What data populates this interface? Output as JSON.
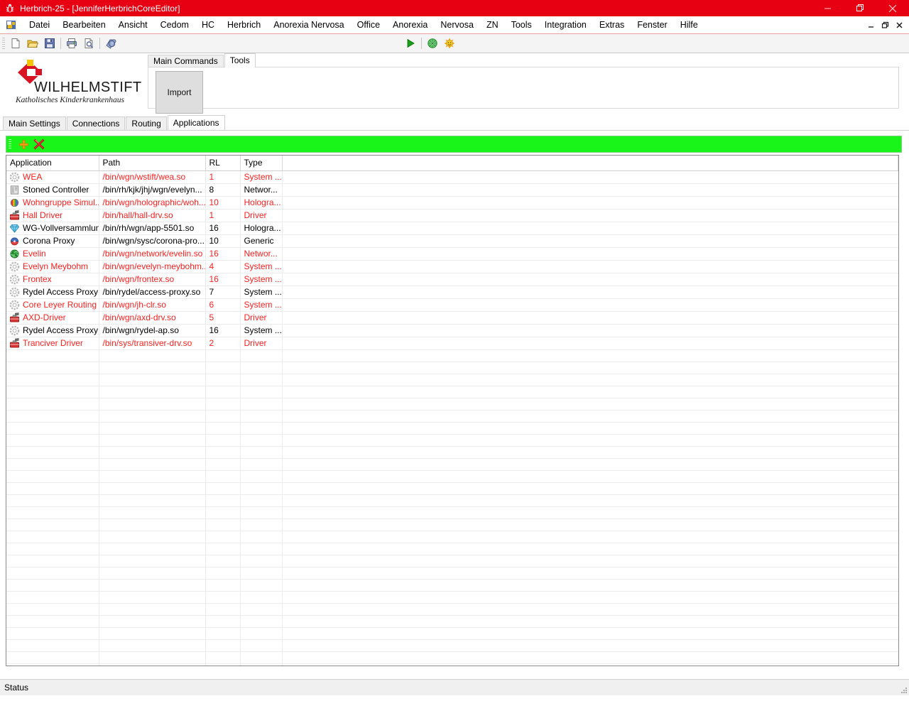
{
  "window": {
    "title": "Herbrich-25 - [JenniferHerbrichCoreEditor]",
    "app_icon": "bug-icon",
    "controls": {
      "minimize": "minimize-icon",
      "restore": "restore-icon",
      "close": "close-icon"
    },
    "mdi_controls": {
      "minimize": "mdi-minimize-icon",
      "restore": "mdi-restore-icon",
      "close": "mdi-close-icon"
    },
    "titlebar_color": "#e60012"
  },
  "menubar": {
    "icon": "mdi-document-icon",
    "items": [
      {
        "label": "Datei"
      },
      {
        "label": "Bearbeiten"
      },
      {
        "label": "Ansicht"
      },
      {
        "label": "Cedom"
      },
      {
        "label": "HC"
      },
      {
        "label": "Herbrich"
      },
      {
        "label": "Anorexia Nervosa"
      },
      {
        "label": "Office"
      },
      {
        "label": "Anorexia"
      },
      {
        "label": "Nervosa"
      },
      {
        "label": "ZN"
      },
      {
        "label": "Tools"
      },
      {
        "label": "Integration"
      },
      {
        "label": "Extras"
      },
      {
        "label": "Fenster"
      },
      {
        "label": "Hilfe"
      }
    ]
  },
  "toolbar": {
    "left_buttons": [
      {
        "name": "new-document-icon"
      },
      {
        "name": "open-folder-icon"
      },
      {
        "name": "save-floppy-icon"
      },
      {
        "name": "print-icon"
      },
      {
        "name": "print-preview-icon"
      },
      {
        "name": "help-globe-icon"
      }
    ],
    "right_buttons": [
      {
        "name": "run-play-icon"
      },
      {
        "name": "green-globe-icon"
      },
      {
        "name": "sun-smiley-icon"
      }
    ]
  },
  "logo": {
    "title": "WILHELMSTIFT",
    "subtitle": "Katholisches Kinderkrankenhaus",
    "mark_red": "#d81324",
    "mark_yellow": "#f5c400"
  },
  "ribbon": {
    "tabs": [
      {
        "label": "Main Commands",
        "active": false
      },
      {
        "label": "Tools",
        "active": true
      }
    ],
    "import_button": "Import"
  },
  "page_tabs": [
    {
      "label": "Main Settings",
      "active": false
    },
    {
      "label": "Connections",
      "active": false
    },
    {
      "label": "Routing",
      "active": false
    },
    {
      "label": "Applications",
      "active": true
    }
  ],
  "grid_toolbar": {
    "background": "#19f519",
    "buttons": [
      {
        "name": "add-plus-icon"
      },
      {
        "name": "delete-x-icon"
      }
    ]
  },
  "grid": {
    "columns": [
      "Application",
      "Path",
      "RL",
      "Type"
    ],
    "rows": [
      {
        "icon": "gear-icon",
        "application": "WEA",
        "path": "/bin/wgn/wstift/wea.so",
        "rl": "1",
        "type": "System ...",
        "red": true
      },
      {
        "icon": "book-icon",
        "application": "Stoned Controller",
        "path": "/bin/rh/kjk/jhj/wgn/evelyn...",
        "rl": "8",
        "type": "Networ...",
        "red": false
      },
      {
        "icon": "sphere-icon",
        "application": "Wohngruppe Simul...",
        "path": "/bin/wgn/holographic/woh...",
        "rl": "10",
        "type": "Hologra...",
        "red": true
      },
      {
        "icon": "toolbox-icon",
        "application": "Hall Driver",
        "path": "/bin/hall/hall-drv.so",
        "rl": "1",
        "type": "Driver",
        "red": true
      },
      {
        "icon": "diamond-icon",
        "application": "WG-Vollversammlung",
        "path": "/bin/rh/wgn/app-5501.so",
        "rl": "16",
        "type": "Hologra...",
        "red": false
      },
      {
        "icon": "corona-icon",
        "application": "Corona Proxy",
        "path": "/bin/wgn/sysc/corona-pro...",
        "rl": "10",
        "type": "Generic",
        "red": false
      },
      {
        "icon": "greenglobe-icon",
        "application": "Evelin",
        "path": "/bin/wgn/network/evelin.so",
        "rl": "16",
        "type": "Networ...",
        "red": true
      },
      {
        "icon": "gear-icon",
        "application": "Evelyn Meybohm",
        "path": "/bin/wgn/evelyn-meybohm...",
        "rl": "4",
        "type": "System ...",
        "red": true
      },
      {
        "icon": "gear-icon",
        "application": "Frontex",
        "path": "/bin/wgn/frontex.so",
        "rl": "16",
        "type": "System ...",
        "red": true
      },
      {
        "icon": "gear-icon",
        "application": "Rydel Access Proxy",
        "path": "/bin/rydel/access-proxy.so",
        "rl": "7",
        "type": "System ...",
        "red": false
      },
      {
        "icon": "gear-icon",
        "application": "Core Leyer Routing",
        "path": "/bin/wgn/jh-clr.so",
        "rl": "6",
        "type": "System ...",
        "red": true
      },
      {
        "icon": "toolbox-icon",
        "application": "AXD-Driver",
        "path": "/bin/wgn/axd-drv.so",
        "rl": "5",
        "type": "Driver",
        "red": true
      },
      {
        "icon": "gear-icon",
        "application": "Rydel Access Proxy",
        "path": "/bin/wgn/rydel-ap.so",
        "rl": "16",
        "type": "System ...",
        "red": false
      },
      {
        "icon": "toolbox-icon",
        "application": "Tranciver Driver",
        "path": "/bin/sys/transiver-drv.so",
        "rl": "2",
        "type": "Driver",
        "red": true
      }
    ],
    "empty_row_count": 28,
    "red_text_color": "#ff2020"
  },
  "statusbar": {
    "text": "Status"
  }
}
